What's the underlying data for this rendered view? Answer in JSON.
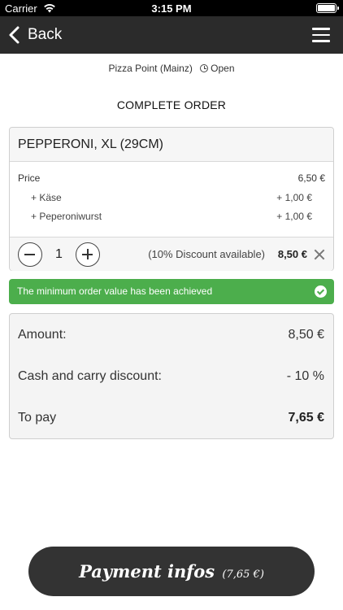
{
  "status_bar": {
    "carrier": "Carrier",
    "time": "3:15 PM"
  },
  "nav": {
    "back_label": "Back"
  },
  "shop": {
    "name": "Pizza Point (Mainz)",
    "status": "Open"
  },
  "page": {
    "title": "COMPLETE ORDER"
  },
  "order_item": {
    "name": "PEPPERONI, XL (29CM)",
    "price_label": "Price",
    "price_value": "6,50 €",
    "extras": [
      {
        "label": "+ Käse",
        "value": "+ 1,00 €"
      },
      {
        "label": "+ Peperoniwurst",
        "value": "+ 1,00 €"
      }
    ],
    "quantity": "1",
    "discount_note": "(10% Discount available)",
    "total": "8,50 €"
  },
  "alert": {
    "text": "The minimum order value has been achieved",
    "color": "#4cae4c"
  },
  "summary": {
    "amount_label": "Amount:",
    "amount_value": "8,50 €",
    "discount_label": "Cash and carry discount:",
    "discount_value": "- 10 %",
    "pay_label": "To pay",
    "pay_value": "7,65 €"
  },
  "payment_button": {
    "label": "Payment infos",
    "amount": "(7,65 €)"
  },
  "icons": [
    "wifi-icon",
    "battery-icon",
    "chevron-left-icon",
    "hamburger-menu-icon",
    "clock-icon",
    "minus-icon",
    "plus-icon",
    "close-icon",
    "check-circle-icon"
  ],
  "colors": {
    "nav_bg": "#2b2b2b",
    "success": "#4cae4c",
    "button_bg": "#333333"
  }
}
